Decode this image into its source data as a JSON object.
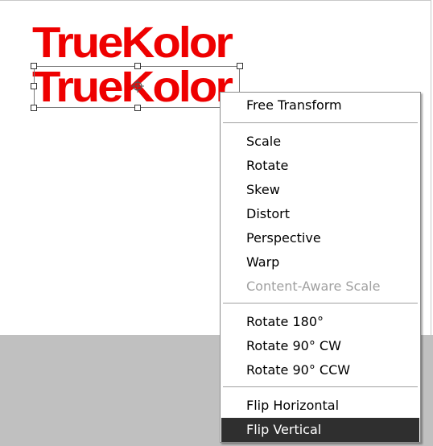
{
  "canvas": {
    "layer_text_top": "TrueKolor",
    "layer_text_bottom": "TrueKolor",
    "text_color": "#ee0000",
    "background_band_color": "#c0c0c0"
  },
  "context_menu": {
    "items": [
      {
        "label": "Free Transform",
        "state": "enabled"
      },
      {
        "label": "Scale",
        "state": "enabled"
      },
      {
        "label": "Rotate",
        "state": "enabled"
      },
      {
        "label": "Skew",
        "state": "enabled"
      },
      {
        "label": "Distort",
        "state": "enabled"
      },
      {
        "label": "Perspective",
        "state": "enabled"
      },
      {
        "label": "Warp",
        "state": "enabled"
      },
      {
        "label": "Content-Aware Scale",
        "state": "disabled"
      },
      {
        "label": "Rotate 180°",
        "state": "enabled"
      },
      {
        "label": "Rotate 90° CW",
        "state": "enabled"
      },
      {
        "label": "Rotate 90° CCW",
        "state": "enabled"
      },
      {
        "label": "Flip Horizontal",
        "state": "enabled"
      },
      {
        "label": "Flip Vertical",
        "state": "highlighted"
      }
    ],
    "highlight_color": "#2f2f2f"
  }
}
